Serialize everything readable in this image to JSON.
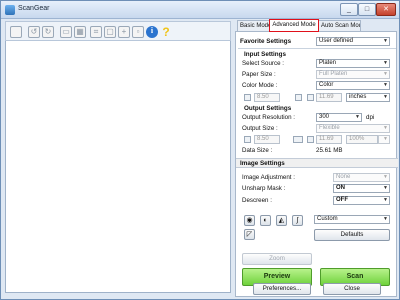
{
  "window": {
    "title": "ScanGear",
    "controls": [
      "_",
      "□",
      "✕"
    ]
  },
  "toolbar": {
    "icons": [
      "scan-icon",
      "rotate-left-icon",
      "rotate-right-icon",
      "auto-crop-icon",
      "multi-crop-icon",
      "crop-icon",
      "delete-crop-icon",
      "zoom-icon",
      "clear-icon",
      "info-icon",
      "help-icon"
    ],
    "info_glyph": "i",
    "help_glyph": "?"
  },
  "tabs": [
    "Basic Mode",
    "Advanced Mode",
    "Auto Scan Mode"
  ],
  "favorite": {
    "label": "Favorite Settings",
    "value": "User defined"
  },
  "input": {
    "heading": "Input Settings",
    "select_source_label": "Select Source :",
    "select_source_value": "Platen",
    "paper_size_label": "Paper Size :",
    "paper_size_value": "Full Platen",
    "color_mode_label": "Color Mode :",
    "color_mode_value": "Color",
    "width": "8.50",
    "height": "11.69",
    "unit": "inches"
  },
  "output": {
    "heading": "Output Settings",
    "resolution_label": "Output Resolution :",
    "resolution_value": "300",
    "dpi": "dpi",
    "size_label": "Output Size :",
    "size_value": "Flexible",
    "width": "8.50",
    "height": "11.69",
    "scale": "100%",
    "data_size_label": "Data Size :",
    "data_size_value": "25.61 MB"
  },
  "image": {
    "heading": "Image Settings",
    "adjustment_label": "Image Adjustment :",
    "adjustment_value": "None",
    "unsharp_label": "Unsharp Mask :",
    "unsharp_value": "ON",
    "descreen_label": "Descreen :",
    "descreen_value": "OFF"
  },
  "tools": {
    "custom_value": "Custom",
    "defaults_label": "Defaults"
  },
  "buttons": {
    "zoom": "Zoom",
    "preview": "Preview",
    "scan": "Scan",
    "preferences": "Preferences...",
    "close": "Close"
  }
}
